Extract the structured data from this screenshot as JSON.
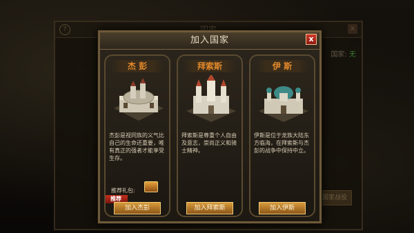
{
  "background": {
    "window_title": "国家",
    "help_label": "?",
    "close_label": "x",
    "nation_label": "国家:",
    "nation_value": "无",
    "side_button_label": "国家战役"
  },
  "modal": {
    "title": "加入国家",
    "close_label": "x"
  },
  "kingdoms": [
    {
      "name": "杰 彭",
      "description": "杰彭是视同族的义气比自己的生命还重要，唯有真正的强者才能享受生存。",
      "gift_label": "推荐礼包:",
      "badge": "推荐",
      "button": "加入杰彭"
    },
    {
      "name": "拜索斯",
      "description": "拜索斯是尊重个人自由及意志，崇尚正义和骑士精神。",
      "button": "加入拜索斯"
    },
    {
      "name": "伊 斯",
      "description": "伊斯是位于龙族大陆东方临海，在拜索斯与杰彭的战争中保持中立。",
      "button": "加入伊斯"
    }
  ]
}
